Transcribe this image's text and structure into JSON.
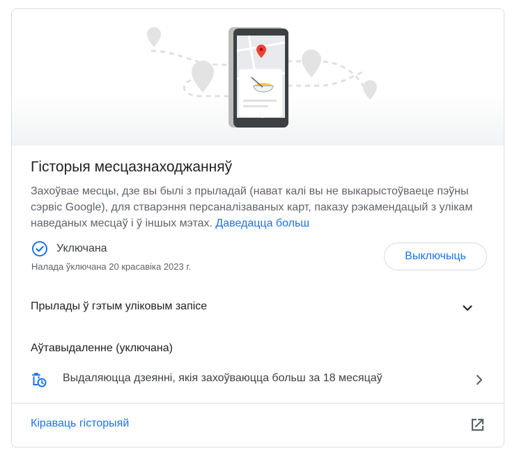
{
  "card": {
    "title": "Гісторыя месцазнаходжанняў",
    "description": "Захоўвае месцы, дзе вы былі з прыладай (нават калі вы не выкарыстоўваеце пэўны сэрвіс Google), для стварэння персаналізаваных карт, паказу рэкамендацый з улікам наведаных месцаў і ў іншых мэтах.",
    "learn_more": "Даведацца больш"
  },
  "status": {
    "label": "Уключана",
    "date": "Налада ўключана 20 красавіка 2023 г.",
    "icon": "check-circle-icon"
  },
  "turn_off_button": "Выключыць",
  "devices": {
    "label": "Прылады ў гэтым уліковым запісе",
    "icon": "chevron-down-icon"
  },
  "auto_delete": {
    "title": "Аўтавыдаленне (уключана)",
    "text": "Выдаляюцца дзеянні, якія захоўваюцца больш за 18 месяцаў",
    "icon": "auto-delete-icon"
  },
  "manage": {
    "label": "Кіраваць гісторыяй",
    "icon": "open-in-new-icon"
  },
  "colors": {
    "accent": "#1a73e8",
    "text_primary": "#202124",
    "text_secondary": "#5f6368",
    "border": "#dadce0",
    "map_pin": "#ea4335"
  }
}
